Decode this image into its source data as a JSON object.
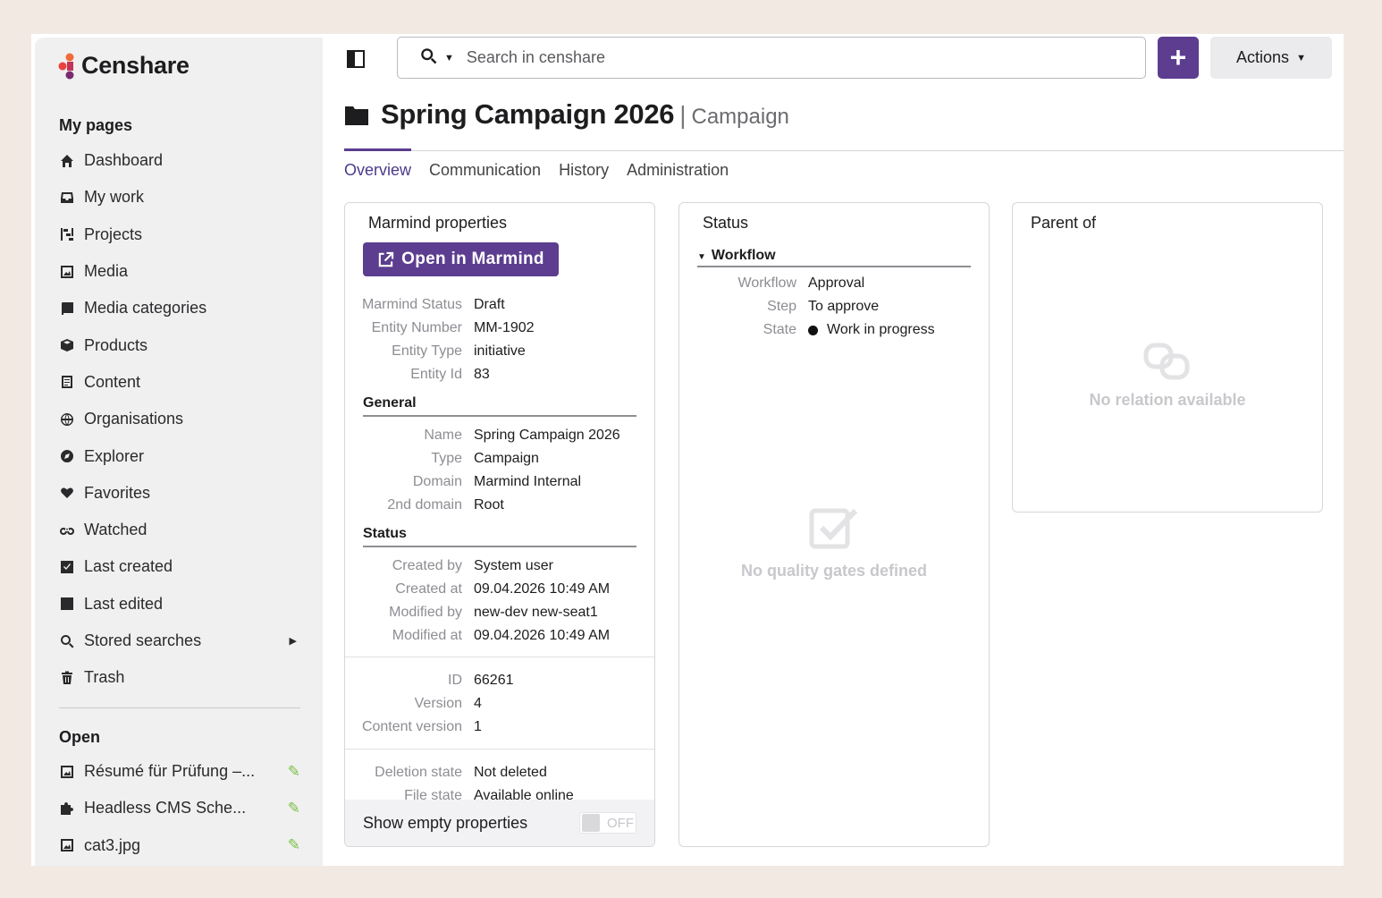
{
  "app": {
    "logo_text": "Censhare"
  },
  "sidebar": {
    "my_pages_title": "My pages",
    "items": [
      {
        "label": "Dashboard",
        "icon": "home-icon"
      },
      {
        "label": "My work",
        "icon": "inbox-icon"
      },
      {
        "label": "Projects",
        "icon": "projects-icon"
      },
      {
        "label": "Media",
        "icon": "image-icon"
      },
      {
        "label": "Media categories",
        "icon": "book-icon"
      },
      {
        "label": "Products",
        "icon": "box-icon"
      },
      {
        "label": "Content",
        "icon": "document-icon"
      },
      {
        "label": "Organisations",
        "icon": "globe-icon"
      },
      {
        "label": "Explorer",
        "icon": "compass-icon"
      },
      {
        "label": "Favorites",
        "icon": "heart-icon"
      },
      {
        "label": "Watched",
        "icon": "binoculars-icon"
      },
      {
        "label": "Last created",
        "icon": "check-square-icon"
      },
      {
        "label": "Last edited",
        "icon": "edit-square-icon"
      },
      {
        "label": "Stored searches",
        "icon": "search-icon"
      },
      {
        "label": "Trash",
        "icon": "trash-icon"
      }
    ],
    "open_title": "Open",
    "open_items": [
      {
        "label": "Résumé für Prüfung –...",
        "icon": "image-icon"
      },
      {
        "label": "Headless CMS Sche...",
        "icon": "puzzle-icon"
      },
      {
        "label": "cat3.jpg",
        "icon": "image-icon"
      }
    ]
  },
  "topbar": {
    "search_placeholder": "Search in censhare",
    "plus_label": "+",
    "actions_label": "Actions"
  },
  "page": {
    "title": "Spring Campaign 2026",
    "separator": "|",
    "type": "Campaign",
    "tabs": [
      "Overview",
      "Communication",
      "History",
      "Administration"
    ],
    "active_tab": "Overview"
  },
  "marmind_card": {
    "title": "Marmind properties",
    "open_button": "Open in Marmind",
    "props": [
      {
        "k": "Marmind Status",
        "v": "Draft"
      },
      {
        "k": "Entity Number",
        "v": "MM-1902"
      },
      {
        "k": "Entity Type",
        "v": "initiative"
      },
      {
        "k": "Entity Id",
        "v": "83"
      }
    ],
    "general_title": "General",
    "general": [
      {
        "k": "Name",
        "v": "Spring Campaign 2026"
      },
      {
        "k": "Type",
        "v": "Campaign"
      },
      {
        "k": "Domain",
        "v": "Marmind Internal"
      },
      {
        "k": "2nd domain",
        "v": "Root"
      }
    ],
    "status_title": "Status",
    "status": [
      {
        "k": "Created by",
        "v": "System user"
      },
      {
        "k": "Created at",
        "v": "09.04.2026 10:49 AM"
      },
      {
        "k": "Modified by",
        "v": "new-dev new-seat1"
      },
      {
        "k": "Modified at",
        "v": "09.04.2026 10:49 AM"
      }
    ],
    "ids": [
      {
        "k": "ID",
        "v": "66261"
      },
      {
        "k": "Version",
        "v": "4"
      },
      {
        "k": "Content version",
        "v": "1"
      }
    ],
    "states": [
      {
        "k": "Deletion state",
        "v": "Not deleted"
      },
      {
        "k": "File state",
        "v": "Available online"
      }
    ],
    "show_empty_label": "Show empty properties",
    "toggle_label": "OFF"
  },
  "status_card": {
    "title": "Status",
    "workflow_title": "Workflow",
    "props": [
      {
        "k": "Workflow",
        "v": "Approval"
      },
      {
        "k": "Step",
        "v": "To approve"
      },
      {
        "k": "State",
        "v": "Work in progress"
      }
    ],
    "empty_text": "No quality gates defined"
  },
  "parent_card": {
    "title": "Parent of",
    "empty_text": "No relation available"
  },
  "colors": {
    "accent": "#5c3d8f",
    "sidebar_bg": "#f0f0f1",
    "page_bg": "#f2e9e3",
    "edit_green": "#7bc043"
  }
}
